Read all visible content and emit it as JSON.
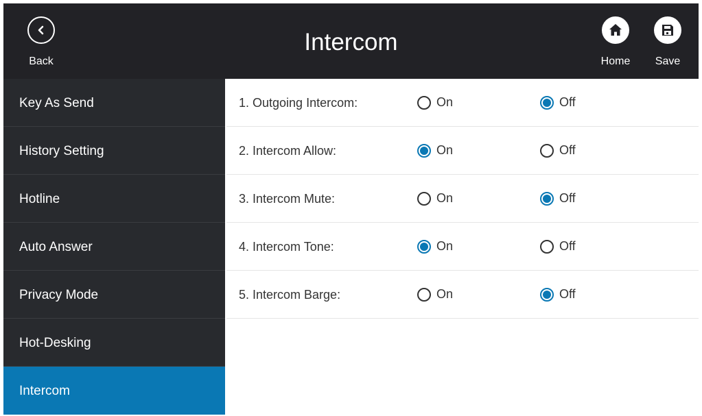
{
  "header": {
    "title": "Intercom",
    "back_label": "Back",
    "home_label": "Home",
    "save_label": "Save",
    "background": "#222226"
  },
  "sidebar": {
    "items": [
      {
        "label": "Key As Send",
        "active": false
      },
      {
        "label": "History Setting",
        "active": false
      },
      {
        "label": "Hotline",
        "active": false
      },
      {
        "label": "Auto Answer",
        "active": false
      },
      {
        "label": "Privacy Mode",
        "active": false
      },
      {
        "label": "Hot-Desking",
        "active": false
      },
      {
        "label": "Intercom",
        "active": true
      }
    ],
    "active_color": "#0a78b4"
  },
  "settings": {
    "on_label": "On",
    "off_label": "Off",
    "rows": [
      {
        "label": "1. Outgoing Intercom:",
        "value": "off"
      },
      {
        "label": "2. Intercom Allow:",
        "value": "on"
      },
      {
        "label": "3. Intercom Mute:",
        "value": "off"
      },
      {
        "label": "4. Intercom Tone:",
        "value": "on"
      },
      {
        "label": "5. Intercom Barge:",
        "value": "off"
      }
    ]
  },
  "icons": {
    "back": "chevron-left-icon",
    "home": "home-icon",
    "save": "floppy-disk-icon"
  }
}
